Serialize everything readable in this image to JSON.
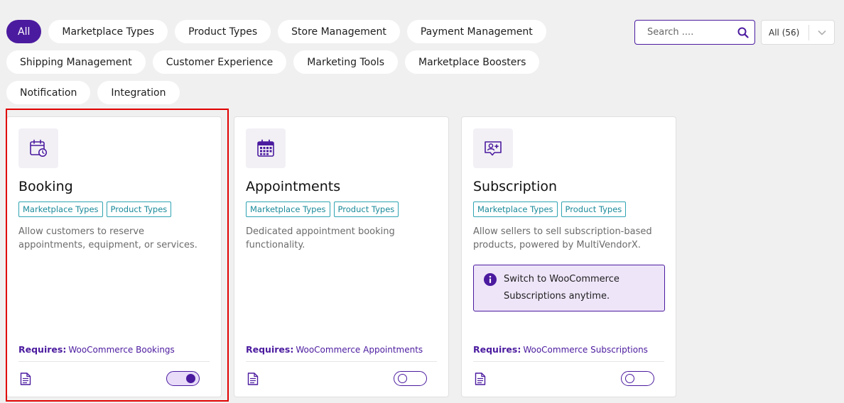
{
  "filters": [
    {
      "label": "All",
      "active": true
    },
    {
      "label": "Marketplace Types"
    },
    {
      "label": "Product Types"
    },
    {
      "label": "Store Management"
    },
    {
      "label": "Payment Management"
    },
    {
      "label": "Shipping Management"
    },
    {
      "label": "Customer Experience"
    },
    {
      "label": "Marketing Tools"
    },
    {
      "label": "Marketplace Boosters"
    },
    {
      "label": "Notification"
    },
    {
      "label": "Integration"
    }
  ],
  "search": {
    "placeholder": "Search ....",
    "icon": "search-icon"
  },
  "select": {
    "value": "All (56)",
    "icon": "chevron-down-icon"
  },
  "colors": {
    "accent": "#4b1b9f",
    "tag": "#1a8a9a",
    "highlight": "#e00000",
    "notice_bg": "#eee5f9"
  },
  "cards": [
    {
      "icon": "calendar-clock-icon",
      "title": "Booking",
      "tags": [
        "Marketplace Types",
        "Product Types"
      ],
      "description": "Allow customers to reserve appointments, equipment, or services.",
      "requires_label": "Requires:",
      "requires_value": "WooCommerce Bookings",
      "doc_icon": "document-icon",
      "enabled": true
    },
    {
      "icon": "calendar-grid-icon",
      "title": "Appointments",
      "tags": [
        "Marketplace Types",
        "Product Types"
      ],
      "description": "Dedicated appointment booking functionality.",
      "requires_label": "Requires:",
      "requires_value": "WooCommerce Appointments",
      "doc_icon": "document-icon",
      "enabled": false
    },
    {
      "icon": "user-add-icon",
      "title": "Subscription",
      "tags": [
        "Marketplace Types",
        "Product Types"
      ],
      "description": "Allow sellers to sell subscription-based products, powered by MultiVendorX.",
      "notice": {
        "icon": "info-icon",
        "text": "Switch to WooCommerce Subscriptions anytime."
      },
      "requires_label": "Requires:",
      "requires_value": "WooCommerce Subscriptions",
      "doc_icon": "document-icon",
      "enabled": false
    }
  ]
}
